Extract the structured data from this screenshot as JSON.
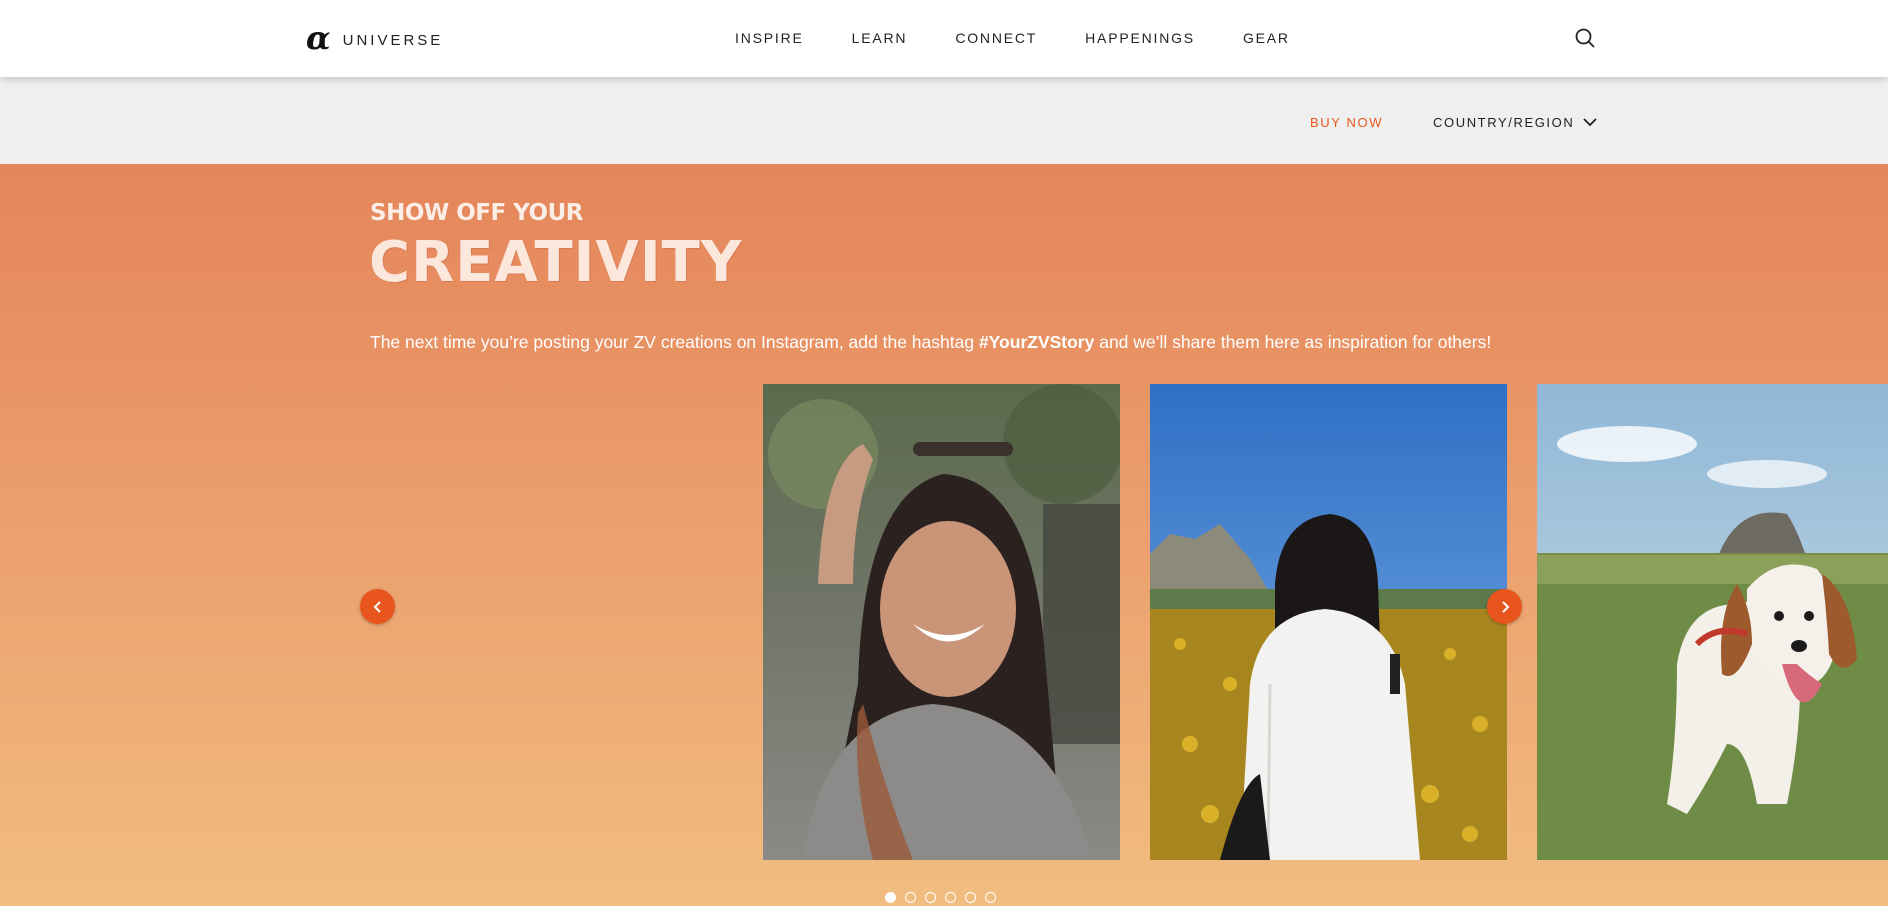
{
  "brand": {
    "mark": "α",
    "name": "UNIVERSE"
  },
  "nav": {
    "links": [
      "INSPIRE",
      "LEARN",
      "CONNECT",
      "HAPPENINGS",
      "GEAR"
    ],
    "search_icon": "search-icon"
  },
  "subnav": {
    "buy_now": "BUY NOW",
    "country_region": "COUNTRY/REGION"
  },
  "hero": {
    "kicker": "SHOW OFF YOUR",
    "headline": "CREATIVITY",
    "description_before": "The next time you’re posting your ZV creations on Instagram, add the hashtag ",
    "hashtag": "#YourZVStory",
    "description_after": " and we’ll share them here as inspiration for others!"
  },
  "carousel": {
    "prev_icon": "chevron-left-icon",
    "next_icon": "chevron-right-icon",
    "slide_count": 6,
    "active_slide": 1
  },
  "colors": {
    "accent": "#e8561d",
    "hero_top": "#e5855a",
    "hero_bottom": "#f1bd80"
  }
}
